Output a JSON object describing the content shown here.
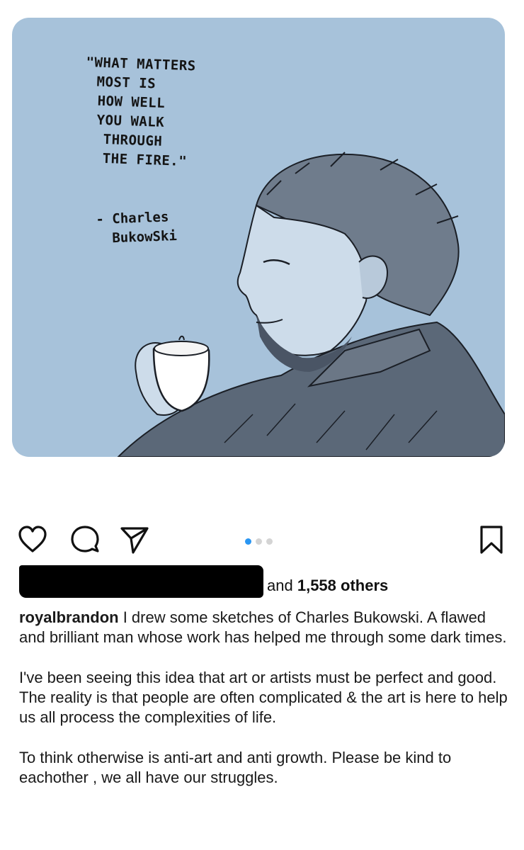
{
  "post": {
    "image": {
      "quote_lines": [
        "\"WHAT MATTERS",
        "MOST IS",
        "HOW WELL",
        "YOU WALK",
        "THROUGH",
        "THE FIRE.\""
      ],
      "author_lines": [
        "- Charles",
        "BukowSki"
      ],
      "background_color": "#a7c2da"
    },
    "carousel": {
      "count": 3,
      "active_index": 0
    },
    "actions": {
      "like_icon": "heart-icon",
      "comment_icon": "comment-icon",
      "share_icon": "paper-plane-icon",
      "save_icon": "bookmark-icon"
    },
    "likes": {
      "prefix": "and",
      "count_text": "1,558 others"
    },
    "caption": {
      "username": "royalbrandon",
      "paragraphs": [
        "I drew some sketches of Charles Bukowski. A flawed and brilliant man whose work has helped me through some dark times.",
        "I've been seeing this idea that art or artists must be perfect and good. The reality is that people are often complicated & the art is here to help us all process the complexities of life.",
        "To think otherwise is anti-art and anti growth. Please be kind to eachother , we all have our struggles."
      ]
    }
  }
}
